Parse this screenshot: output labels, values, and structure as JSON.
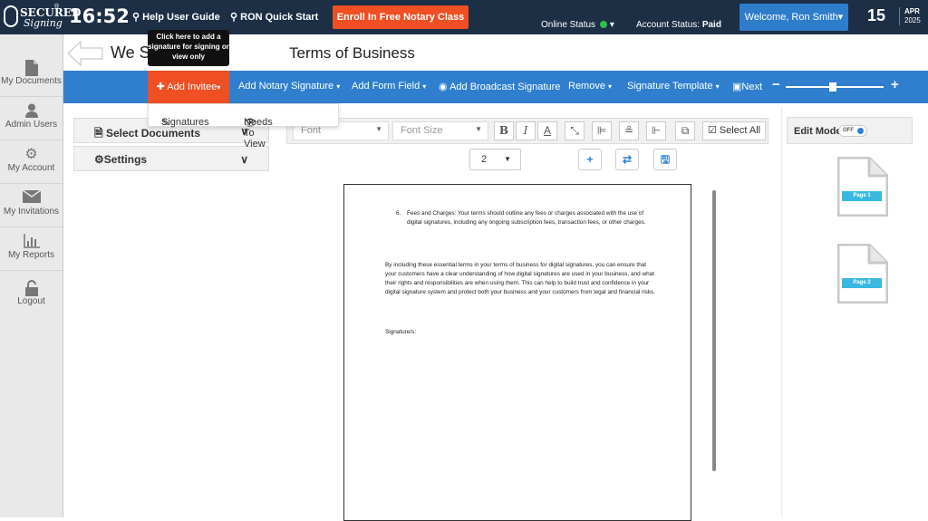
{
  "header": {
    "logo_text_top": "SECURED",
    "logo_text_bottom": "Signing",
    "logo_mark": "®",
    "time": "16:52",
    "help_user_guide": "Help User Guide",
    "ron_quick_start": "RON Quick Start",
    "enroll_button": "Enroll In Free Notary Class",
    "online_status_label": "Online Status",
    "online_status_caret": "▾",
    "account_status_label": "Account Status:",
    "account_status_value": "Paid",
    "welcome": "Welcome,  Ron Smith",
    "welcome_caret": "▾",
    "date_day": "15",
    "date_month": "APR",
    "date_year": "2025",
    "colors": {
      "bar": "#1c2f45",
      "enroll": "#f04e23",
      "welcome": "#2e7dcb",
      "online": "#2fbf4c"
    }
  },
  "sidebar": {
    "items": [
      {
        "label": "My Documents",
        "icon": "document-icon"
      },
      {
        "label": "Admin Users",
        "icon": "user-icon"
      },
      {
        "label": "My Account",
        "icon": "gear-icon"
      },
      {
        "label": "My Invitations",
        "icon": "envelope-icon"
      },
      {
        "label": "My Reports",
        "icon": "bar-chart-icon"
      },
      {
        "label": "Logout",
        "icon": "unlock-icon"
      }
    ]
  },
  "document": {
    "title_left": "We Si",
    "title": "Terms of Business"
  },
  "tooltip": {
    "text": "Click here to add a signature for signing or view only"
  },
  "toolbar": {
    "add_invitee": "Add Invitee",
    "add_notary_signature": "Add Notary Signature",
    "add_form_field": "Add Form Field",
    "add_broadcast_signature": "Add Broadcast Signature",
    "remove": "Remove",
    "signature_template": "Signature Template",
    "next": "Next",
    "zoom_minus": "−",
    "zoom_plus": "+",
    "zoom_level": 0.48,
    "colors": {
      "bar": "#2f7fce",
      "active": "#f04e23"
    }
  },
  "dropdown": {
    "signatures": "Signatures",
    "needs_to_view": "Needs To View"
  },
  "left_panels": {
    "select_documents": "Select Documents",
    "settings": "Settings"
  },
  "format_bar": {
    "font_placeholder": "Font",
    "font_size_placeholder": "Font Size",
    "bold": "B",
    "italic": "I",
    "underline": "A",
    "select_all": "Select All"
  },
  "page_controls": {
    "page_value": "2"
  },
  "page_content": {
    "item_number": "6.",
    "item_text": "Fees and Charges: Your terms should outline any fees or charges associated with the use of digital signatures, including any ongoing subscription fees, transaction fees, or other charges.",
    "paragraph": "By including these essential terms in your terms of business for digital signatures, you can ensure that your customers have a clear understanding of how digital signatures are used in your business, and what their rights and responsibilities are when using them. This can help to build trust and confidence in your digital signature system and protect both your business and your customers from legal and financial risks.",
    "signature_label": "Signature/s:"
  },
  "right_panel": {
    "edit_mode_label": "Edit Mode",
    "toggle_text": "OFF",
    "pages": [
      "Page 1",
      "Page 2"
    ]
  }
}
